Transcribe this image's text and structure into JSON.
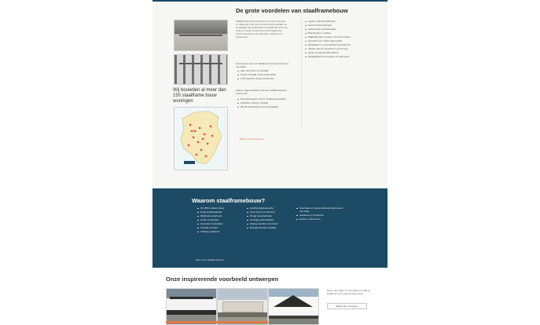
{
  "upper": {
    "title": "De grote voordelen van staalframebouw",
    "map_heading": "Wij bouwden al meer dan 150 staalframe bouw woningen",
    "intro": "Staalframebouw is bezig aan een grote opmars en daarmee is dit één van de meest populaire en veelzijdige bouwmethoden in Nederland. Door de lichte en sterke constructie is het ideaal voor zowel nieuwbouw als renovatie, optoppen en aanbouwen.",
    "sub1": "Het bouwen van een staalframe woning heeft veel voordelen",
    "list1": [
      "Zeer duurzaam en circulair",
      "Snelle bouwtijd, korte doorlooptijd",
      "Licht gewicht, sterke constructie"
    ],
    "sub2": "Andere eigenschappen van een staalframebouw woning zijn",
    "list2": [
      "Energiebesparend door uitstekende isolatie",
      "Flexibele indeling mogelijk",
      "Minder bouwafval op de bouwplaats"
    ],
    "list3": [
      "Lagere onderhoudskosten",
      "Gezond binnenklimaat",
      "Uitstekende geluidsisolatie",
      "Brandveilig en stabiel",
      "Makkelijk aan te passen of uit te breiden",
      "Geschikt voor vrijwel elke locatie",
      "Betaalbaar en voorspelbaar bouwproces",
      "Voldoet aan de nieuwste bouwnormen",
      "Hoge energieprestatie (EPC)",
      "Mogelijkheid tot optoppen en uitbouwen"
    ],
    "link": "Bekijk ons bouwproces"
  },
  "blue": {
    "title": "Waarom staalframebouw?",
    "col1": [
      "Tot 30% snellere bouw",
      "Hoge isolatiewaarde",
      "Minimaal onderhoud",
      "Lichte constructie",
      "Duurzame materialen",
      "Circulair bouwen",
      "Volledig maatwerk"
    ],
    "col2": [
      "Aardbevingsbestendig",
      "Geen krimp of scheuren",
      "Droge bouwmethode",
      "Gunstige prijs-kwaliteit",
      "Weinig overlast in de buurt",
      "Energieneutraal mogelijk"
    ],
    "col3": [
      "Duurzaam en toekomstbestendig bouwen met staal",
      "Garantie op constructie",
      "Ervaren vakmensen"
    ],
    "link": "Meer over staalframebouw"
  },
  "bottom": {
    "title": "Onze inspirerende voorbeeld ontwerpen",
    "side_text": "Neem een kijkje in onze gallerij en laat je inspireren voor jouw droomwoning.",
    "side_button": "Bekijk alle ontwerpen"
  }
}
